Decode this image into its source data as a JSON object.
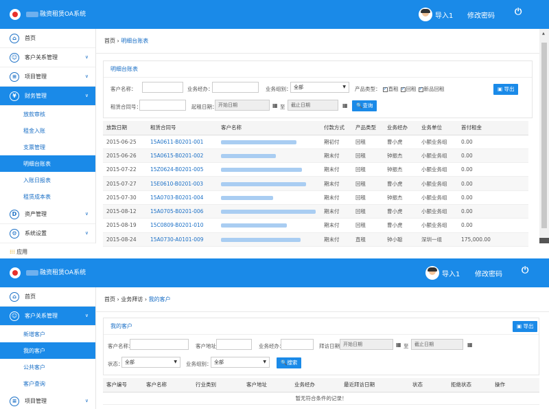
{
  "panel1": {
    "header": {
      "app_title": "融资租赁OA系统",
      "user_name": "导入1",
      "change_password": "修改密码",
      "power_icon": "power-icon"
    },
    "sidebar": {
      "items": [
        {
          "label": "首页",
          "icon": "home-icon"
        },
        {
          "label": "客户关系管理",
          "icon": "users-icon"
        },
        {
          "label": "项目管理",
          "icon": "list-icon"
        },
        {
          "label": "财务管理",
          "icon": "yen-icon"
        },
        {
          "label": "资产管理",
          "icon": "asset-icon"
        },
        {
          "label": "系统设置",
          "icon": "gear-icon"
        }
      ],
      "finance_sub": [
        "放款审核",
        "租金入账",
        "支票管理",
        "明细台账表",
        "入账日报表",
        "租赁成本表"
      ],
      "apps": "应用"
    },
    "breadcrumb": {
      "home": "首页",
      "sep": "›",
      "current": "明细台账表"
    },
    "card_title": "明细台账表",
    "filters": {
      "customer_name": "客户名称：",
      "manager": "业务经办：",
      "group": "业务组别：",
      "group_value": "全部",
      "product_type": "产品类型：",
      "product_opts": [
        "直租",
        "回租",
        "新品回租"
      ],
      "contract_no": "租赁合同号：",
      "start_date": "起租日期：",
      "start_ph": "开始日期",
      "to": "至",
      "end_ph": "截止日期",
      "search": "查询",
      "export": "导出"
    },
    "table": {
      "headers": [
        "放款日期",
        "租赁合同号",
        "客户名称",
        "付款方式",
        "产品类型",
        "业务经办",
        "业务单位",
        "首付租金"
      ],
      "rows": [
        [
          "2015-06-25",
          "15A0611-B0201-001",
          "期初付",
          "回租",
          "曹小虎",
          "小额业务组",
          "0.00"
        ],
        [
          "2015-06-26",
          "15A0615-B0201-002",
          "期末付",
          "回租",
          "钟振杰",
          "小额业务组",
          "0.00"
        ],
        [
          "2015-07-22",
          "15Z0624-B0201-005",
          "期末付",
          "回租",
          "钟振杰",
          "小额业务组",
          "0.00"
        ],
        [
          "2015-07-27",
          "15E0610-B0201-003",
          "期末付",
          "回租",
          "曹小虎",
          "小额业务组",
          "0.00"
        ],
        [
          "2015-07-30",
          "15A0703-B0201-004",
          "期末付",
          "回租",
          "钟振杰",
          "小额业务组",
          "0.00"
        ],
        [
          "2015-08-12",
          "15A0705-B0201-006",
          "期末付",
          "回租",
          "曹小虎",
          "小额业务组",
          "0.00"
        ],
        [
          "2015-08-19",
          "15C0809-B0201-010",
          "期末付",
          "回租",
          "曹小虎",
          "小额业务组",
          "0.00"
        ],
        [
          "2015-08-24",
          "15A0730-A0101-009",
          "期末付",
          "直租",
          "钟小聪",
          "深圳一组",
          "175,000.00"
        ]
      ]
    }
  },
  "panel2": {
    "header": {
      "app_title": "融资租赁OA系统",
      "user_name": "导入1",
      "change_password": "修改密码"
    },
    "sidebar": {
      "items": [
        {
          "label": "首页",
          "icon": "home-icon"
        },
        {
          "label": "客户关系管理",
          "icon": "users-icon"
        },
        {
          "label": "项目管理",
          "icon": "list-icon"
        }
      ],
      "crm_sub": [
        "新增客户",
        "我的客户",
        "公共客户",
        "客户查询"
      ]
    },
    "breadcrumb": {
      "home": "首页",
      "mid": "业务拜访",
      "current": "我的客户"
    },
    "card_title": "我的客户",
    "filters": {
      "customer_name": "客户名称：",
      "address": "客户地址：",
      "manager": "业务经办：",
      "visit_date": "拜访日期：",
      "start_ph": "开始日期",
      "to": "至",
      "end_ph": "截止日期",
      "status": "状态：",
      "status_value": "全部",
      "group": "业务组别：",
      "group_value": "全部",
      "search": "搜索",
      "export": "导出"
    },
    "table": {
      "headers": [
        "客户编号",
        "客户名称",
        "行业类别",
        "客户地址",
        "业务经办",
        "最近拜访日期",
        "状态",
        "拒绝状态",
        "操作"
      ],
      "empty": "暂无符合条件的记录！"
    }
  }
}
